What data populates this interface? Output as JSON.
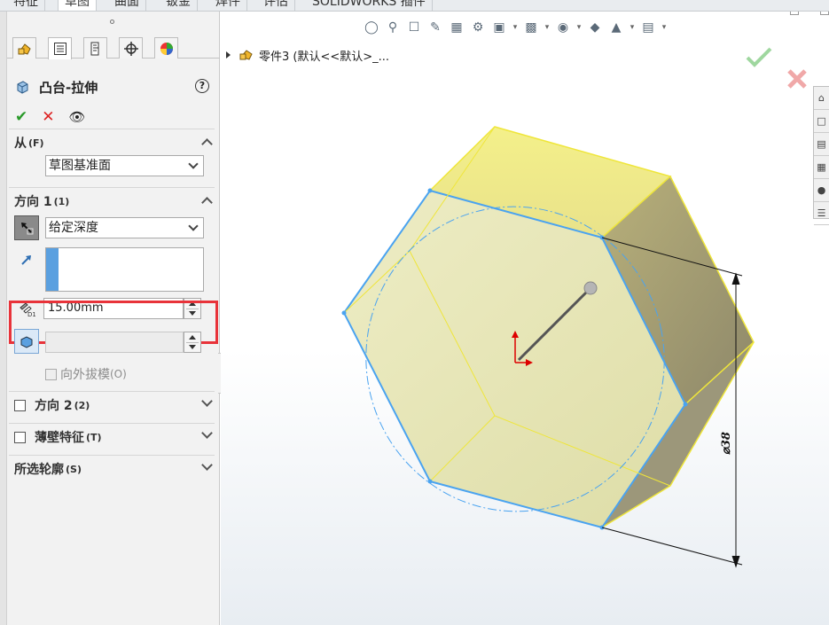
{
  "command_tabs": [
    "特征",
    "草图",
    "曲面",
    "钣金",
    "焊件",
    "评估",
    "SOLIDWORKS 插件"
  ],
  "active_tab_index": 1,
  "panel_tab_icons": [
    "featuremanager-icon",
    "propertymanager-icon",
    "configurationmanager-icon",
    "dimxpert-icon",
    "display-manager-icon"
  ],
  "feature": {
    "title": "凸台-拉伸",
    "help_glyph": "?",
    "ok_glyph": "✔",
    "cancel_glyph": "✕",
    "preview_glyph": "👁"
  },
  "from_section": {
    "title": "从",
    "shortcut": "(F)",
    "value": "草图基准面"
  },
  "direction1": {
    "title": "方向 1",
    "shortcut": "(1)",
    "end_condition": "给定深度",
    "depth_value": "15.00mm",
    "draft_outward_label": "向外拔模",
    "draft_outward_shortcut": "(O)"
  },
  "direction2": {
    "title": "方向 2",
    "shortcut": "(2)"
  },
  "thin_feature": {
    "title": "薄壁特征",
    "shortcut": "(T)"
  },
  "selected_contours": {
    "title": "所选轮廓",
    "shortcut": "(S)"
  },
  "tree": {
    "text": "零件3  (默认<<默认>_..."
  },
  "dimension_label": "⌀38",
  "colors": {
    "highlight_border": "#e8333a",
    "hex_face": "#e7e6a8",
    "hex_edge_selected": "#4aa3f0",
    "hex_edge": "#f2ea37"
  }
}
